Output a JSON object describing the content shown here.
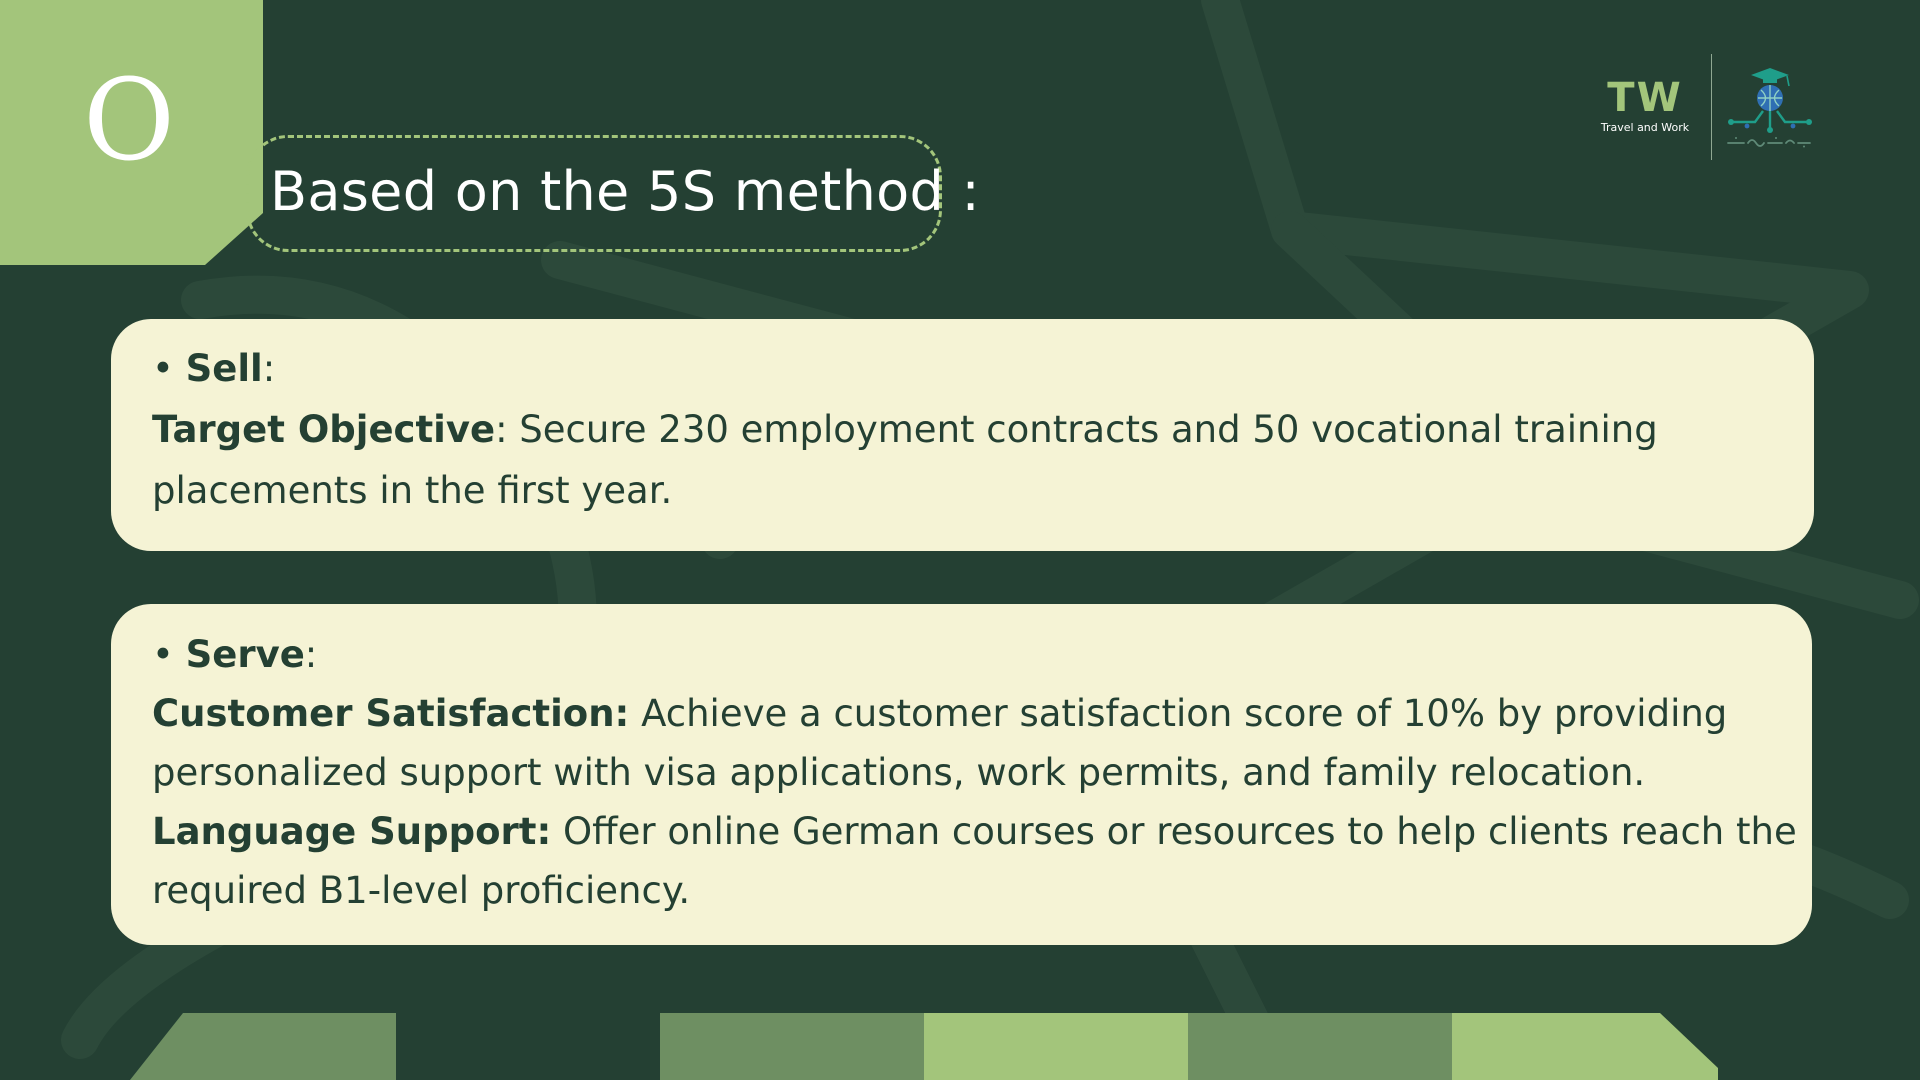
{
  "slide": {
    "section_letter": "O",
    "title": "Based on the 5S method :"
  },
  "logos": {
    "tw_mark": "TW",
    "tw_caption": "Travel and Work",
    "partner_icon": "globe-graduation-cap-icon"
  },
  "sell_card": {
    "heading": "Sell",
    "bullet": "• ",
    "colon": ":",
    "objective_label": "Target Objective",
    "objective_text_1": ": Secure 230 employment contracts and 50 vocational training",
    "objective_text_2": "placements in the first year."
  },
  "serve_card": {
    "heading": "Serve",
    "bullet": "• ",
    "colon": ":",
    "satisfaction_label": "Customer Satisfaction:",
    "satisfaction_text_1": " Achieve a customer satisfaction score of 10% by providing",
    "satisfaction_text_2": "personalized support with visa applications, work permits, and family relocation.",
    "language_label": "Language Support:",
    "language_text_1": " Offer online German courses or resources to help clients reach the",
    "language_text_2": "required B1-level proficiency."
  },
  "colors": {
    "background": "#244033",
    "accent_light_green": "#a3c57b",
    "accent_mid_green": "#6e8f62",
    "card_background": "#f5f3d5",
    "text_dark": "#244033",
    "logo_teal": "#1f9e8a",
    "logo_blue": "#2f6fb3"
  }
}
